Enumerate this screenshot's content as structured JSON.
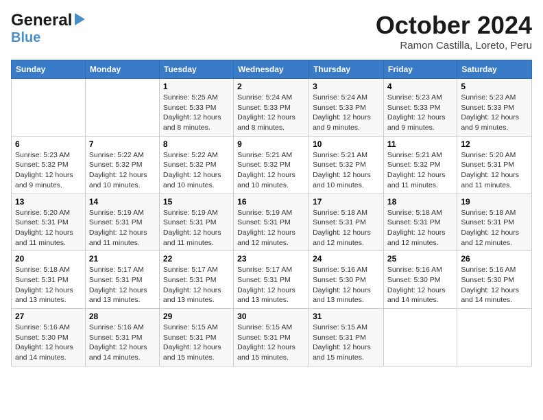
{
  "header": {
    "logo_general": "General",
    "logo_blue": "Blue",
    "month_title": "October 2024",
    "location": "Ramon Castilla, Loreto, Peru"
  },
  "columns": [
    "Sunday",
    "Monday",
    "Tuesday",
    "Wednesday",
    "Thursday",
    "Friday",
    "Saturday"
  ],
  "weeks": [
    [
      {
        "num": "",
        "sunrise": "",
        "sunset": "",
        "daylight": ""
      },
      {
        "num": "",
        "sunrise": "",
        "sunset": "",
        "daylight": ""
      },
      {
        "num": "1",
        "sunrise": "Sunrise: 5:25 AM",
        "sunset": "Sunset: 5:33 PM",
        "daylight": "Daylight: 12 hours and 8 minutes."
      },
      {
        "num": "2",
        "sunrise": "Sunrise: 5:24 AM",
        "sunset": "Sunset: 5:33 PM",
        "daylight": "Daylight: 12 hours and 8 minutes."
      },
      {
        "num": "3",
        "sunrise": "Sunrise: 5:24 AM",
        "sunset": "Sunset: 5:33 PM",
        "daylight": "Daylight: 12 hours and 9 minutes."
      },
      {
        "num": "4",
        "sunrise": "Sunrise: 5:23 AM",
        "sunset": "Sunset: 5:33 PM",
        "daylight": "Daylight: 12 hours and 9 minutes."
      },
      {
        "num": "5",
        "sunrise": "Sunrise: 5:23 AM",
        "sunset": "Sunset: 5:33 PM",
        "daylight": "Daylight: 12 hours and 9 minutes."
      }
    ],
    [
      {
        "num": "6",
        "sunrise": "Sunrise: 5:23 AM",
        "sunset": "Sunset: 5:32 PM",
        "daylight": "Daylight: 12 hours and 9 minutes."
      },
      {
        "num": "7",
        "sunrise": "Sunrise: 5:22 AM",
        "sunset": "Sunset: 5:32 PM",
        "daylight": "Daylight: 12 hours and 10 minutes."
      },
      {
        "num": "8",
        "sunrise": "Sunrise: 5:22 AM",
        "sunset": "Sunset: 5:32 PM",
        "daylight": "Daylight: 12 hours and 10 minutes."
      },
      {
        "num": "9",
        "sunrise": "Sunrise: 5:21 AM",
        "sunset": "Sunset: 5:32 PM",
        "daylight": "Daylight: 12 hours and 10 minutes."
      },
      {
        "num": "10",
        "sunrise": "Sunrise: 5:21 AM",
        "sunset": "Sunset: 5:32 PM",
        "daylight": "Daylight: 12 hours and 10 minutes."
      },
      {
        "num": "11",
        "sunrise": "Sunrise: 5:21 AM",
        "sunset": "Sunset: 5:32 PM",
        "daylight": "Daylight: 12 hours and 11 minutes."
      },
      {
        "num": "12",
        "sunrise": "Sunrise: 5:20 AM",
        "sunset": "Sunset: 5:31 PM",
        "daylight": "Daylight: 12 hours and 11 minutes."
      }
    ],
    [
      {
        "num": "13",
        "sunrise": "Sunrise: 5:20 AM",
        "sunset": "Sunset: 5:31 PM",
        "daylight": "Daylight: 12 hours and 11 minutes."
      },
      {
        "num": "14",
        "sunrise": "Sunrise: 5:19 AM",
        "sunset": "Sunset: 5:31 PM",
        "daylight": "Daylight: 12 hours and 11 minutes."
      },
      {
        "num": "15",
        "sunrise": "Sunrise: 5:19 AM",
        "sunset": "Sunset: 5:31 PM",
        "daylight": "Daylight: 12 hours and 11 minutes."
      },
      {
        "num": "16",
        "sunrise": "Sunrise: 5:19 AM",
        "sunset": "Sunset: 5:31 PM",
        "daylight": "Daylight: 12 hours and 12 minutes."
      },
      {
        "num": "17",
        "sunrise": "Sunrise: 5:18 AM",
        "sunset": "Sunset: 5:31 PM",
        "daylight": "Daylight: 12 hours and 12 minutes."
      },
      {
        "num": "18",
        "sunrise": "Sunrise: 5:18 AM",
        "sunset": "Sunset: 5:31 PM",
        "daylight": "Daylight: 12 hours and 12 minutes."
      },
      {
        "num": "19",
        "sunrise": "Sunrise: 5:18 AM",
        "sunset": "Sunset: 5:31 PM",
        "daylight": "Daylight: 12 hours and 12 minutes."
      }
    ],
    [
      {
        "num": "20",
        "sunrise": "Sunrise: 5:18 AM",
        "sunset": "Sunset: 5:31 PM",
        "daylight": "Daylight: 12 hours and 13 minutes."
      },
      {
        "num": "21",
        "sunrise": "Sunrise: 5:17 AM",
        "sunset": "Sunset: 5:31 PM",
        "daylight": "Daylight: 12 hours and 13 minutes."
      },
      {
        "num": "22",
        "sunrise": "Sunrise: 5:17 AM",
        "sunset": "Sunset: 5:31 PM",
        "daylight": "Daylight: 12 hours and 13 minutes."
      },
      {
        "num": "23",
        "sunrise": "Sunrise: 5:17 AM",
        "sunset": "Sunset: 5:31 PM",
        "daylight": "Daylight: 12 hours and 13 minutes."
      },
      {
        "num": "24",
        "sunrise": "Sunrise: 5:16 AM",
        "sunset": "Sunset: 5:30 PM",
        "daylight": "Daylight: 12 hours and 13 minutes."
      },
      {
        "num": "25",
        "sunrise": "Sunrise: 5:16 AM",
        "sunset": "Sunset: 5:30 PM",
        "daylight": "Daylight: 12 hours and 14 minutes."
      },
      {
        "num": "26",
        "sunrise": "Sunrise: 5:16 AM",
        "sunset": "Sunset: 5:30 PM",
        "daylight": "Daylight: 12 hours and 14 minutes."
      }
    ],
    [
      {
        "num": "27",
        "sunrise": "Sunrise: 5:16 AM",
        "sunset": "Sunset: 5:30 PM",
        "daylight": "Daylight: 12 hours and 14 minutes."
      },
      {
        "num": "28",
        "sunrise": "Sunrise: 5:16 AM",
        "sunset": "Sunset: 5:31 PM",
        "daylight": "Daylight: 12 hours and 14 minutes."
      },
      {
        "num": "29",
        "sunrise": "Sunrise: 5:15 AM",
        "sunset": "Sunset: 5:31 PM",
        "daylight": "Daylight: 12 hours and 15 minutes."
      },
      {
        "num": "30",
        "sunrise": "Sunrise: 5:15 AM",
        "sunset": "Sunset: 5:31 PM",
        "daylight": "Daylight: 12 hours and 15 minutes."
      },
      {
        "num": "31",
        "sunrise": "Sunrise: 5:15 AM",
        "sunset": "Sunset: 5:31 PM",
        "daylight": "Daylight: 12 hours and 15 minutes."
      },
      {
        "num": "",
        "sunrise": "",
        "sunset": "",
        "daylight": ""
      },
      {
        "num": "",
        "sunrise": "",
        "sunset": "",
        "daylight": ""
      }
    ]
  ]
}
